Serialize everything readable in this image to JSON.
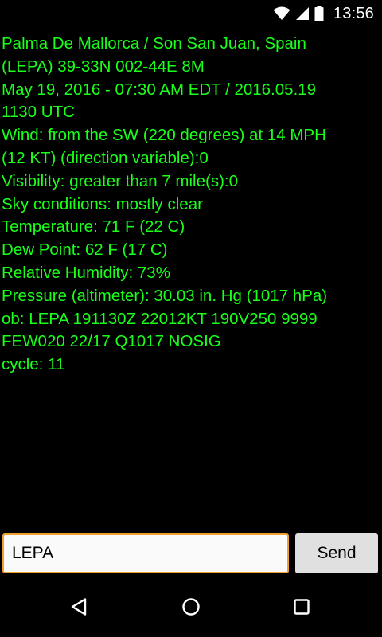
{
  "status_bar": {
    "time": "13:56",
    "icons": [
      "wifi-icon",
      "cell-signal-icon",
      "battery-icon"
    ]
  },
  "weather": {
    "lines": [
      "Palma De Mallorca / Son San Juan, Spain",
      "(LEPA) 39-33N 002-44E 8M",
      "May 19, 2016 - 07:30 AM EDT / 2016.05.19",
      "1130 UTC",
      "Wind: from the SW (220 degrees) at 14 MPH",
      "(12 KT) (direction variable):0",
      "Visibility: greater than 7 mile(s):0",
      "Sky conditions: mostly clear",
      "Temperature: 71 F (22 C)",
      "Dew Point: 62 F (17 C)",
      "Relative Humidity: 73%",
      "Pressure (altimeter): 30.03 in. Hg (1017 hPa)",
      "ob: LEPA 191130Z 22012KT 190V250 9999",
      "FEW020 22/17 Q1017 NOSIG",
      "cycle: 11"
    ]
  },
  "form": {
    "station_value": "LEPA",
    "send_label": "Send"
  },
  "nav_bar": {
    "icons": [
      "back-icon",
      "home-icon",
      "recents-icon"
    ]
  },
  "colors": {
    "text": "#1aff1a",
    "background": "#000000",
    "input_border": "#f0a030"
  }
}
